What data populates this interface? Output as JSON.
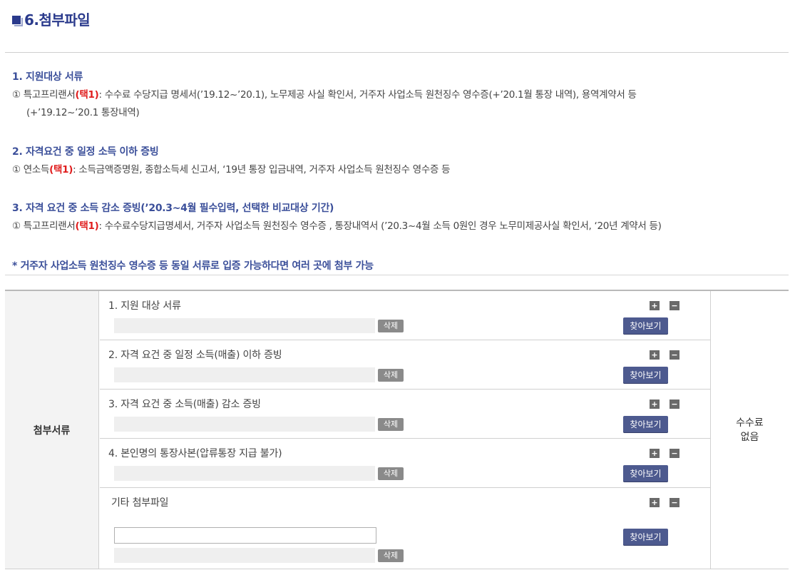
{
  "header": {
    "title": "6.첨부파일"
  },
  "sections": [
    {
      "heading": "1. 지원대상 서류",
      "prefix": "① 특고프리랜서",
      "highlight": "(택1)",
      "text": ": 수수료 수당지급 명세서(’19.12~’20.1), 노무제공 사실 확인서, 거주자 사업소득 원천징수 영수증(+’20.1월 통장 내역), 용역계약서 등",
      "continuation": "(+’19.12~’20.1 통장내역)"
    },
    {
      "heading": "2. 자격요건 중 일정 소득 이하 증빙",
      "prefix": "① 연소득",
      "highlight": "(택1)",
      "text": ": 소득금액증명원, 종합소득세 신고서, ‘19년 통장 입금내역, 거주자 사업소득 원천징수 영수증 등"
    },
    {
      "heading": "3. 자격 요건 중 소득 감소 증빙(’20.3~4월 필수입력, 선택한 비교대상 기간)",
      "prefix": "① 특고프리랜서",
      "highlight": "(택1)",
      "text": ": 수수료수당지급명세서, 거주자 사업소득 원천징수 영수증 , 통장내역서 (’20.3~4월 소득 0원인 경우 노무미제공사실 확인서, ‘20년 계약서 등)"
    }
  ],
  "note": "* 거주자 사업소득 원천징수 영수증 등 동일 서류로 입증 가능하다면 여러 곳에 첨부 가능",
  "table": {
    "header_label": "첨부서류",
    "fee_line1": "수수료",
    "fee_line2": "없음",
    "plus_label": "+",
    "minus_label": "−",
    "delete_label": "삭제",
    "find_label": "찾아보기",
    "rows": [
      {
        "label": "1. 지원 대상 서류"
      },
      {
        "label": "2. 자격 요건 중 일정 소득(매출) 이하 증빙"
      },
      {
        "label": "3. 자격 요건 중 소득(매출) 감소 증빙"
      },
      {
        "label": "4. 본인명의 통장사본(압류통장 지급 불가)"
      },
      {
        "label": "기타 첨부파일",
        "input_value": ""
      }
    ]
  }
}
